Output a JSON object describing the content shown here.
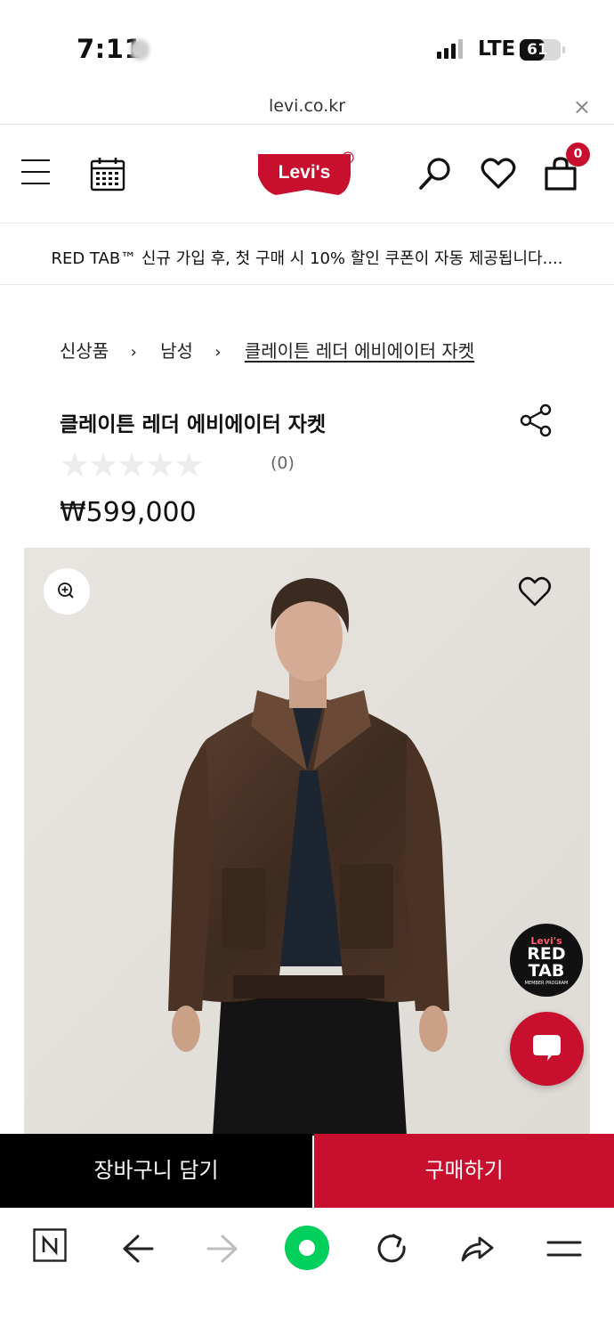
{
  "status_bar": {
    "time": "7:11",
    "network": "LTE",
    "battery_level": "61",
    "battery_percent": 61
  },
  "browser": {
    "url": "levi.co.kr",
    "close_label": "×"
  },
  "header": {
    "logo_text": "Levi's",
    "cart_count": "0"
  },
  "promo": {
    "text": "RED TAB™ 신규 가입 후, 첫 구매 시 10% 할인 쿠폰이 자동 제공됩니다...."
  },
  "breadcrumb": {
    "items": [
      "신상품",
      "남성"
    ],
    "current": "클레이튼 레더 에비에이터 자켓",
    "separator": "›"
  },
  "product": {
    "title": "클레이튼 레더 에비에이터 자켓",
    "rating_stars": 0,
    "review_count": "(0)",
    "price": "₩599,000"
  },
  "badges": {
    "red_tab_line1": "Levi's",
    "red_tab_line2": "RED TAB",
    "red_tab_line3": "MEMBER PROGRAM"
  },
  "actions": {
    "add_to_cart": "장바구니 담기",
    "buy_now": "구매하기"
  },
  "icons": {
    "menu": "hamburger-icon",
    "calendar": "calendar-icon",
    "search": "search-icon",
    "wishlist": "heart-icon",
    "cart": "shopping-bag-icon",
    "share": "share-icon",
    "zoom": "zoom-in-icon",
    "chat": "chat-icon"
  },
  "colors": {
    "brand_red": "#c8102e",
    "black": "#000000"
  }
}
